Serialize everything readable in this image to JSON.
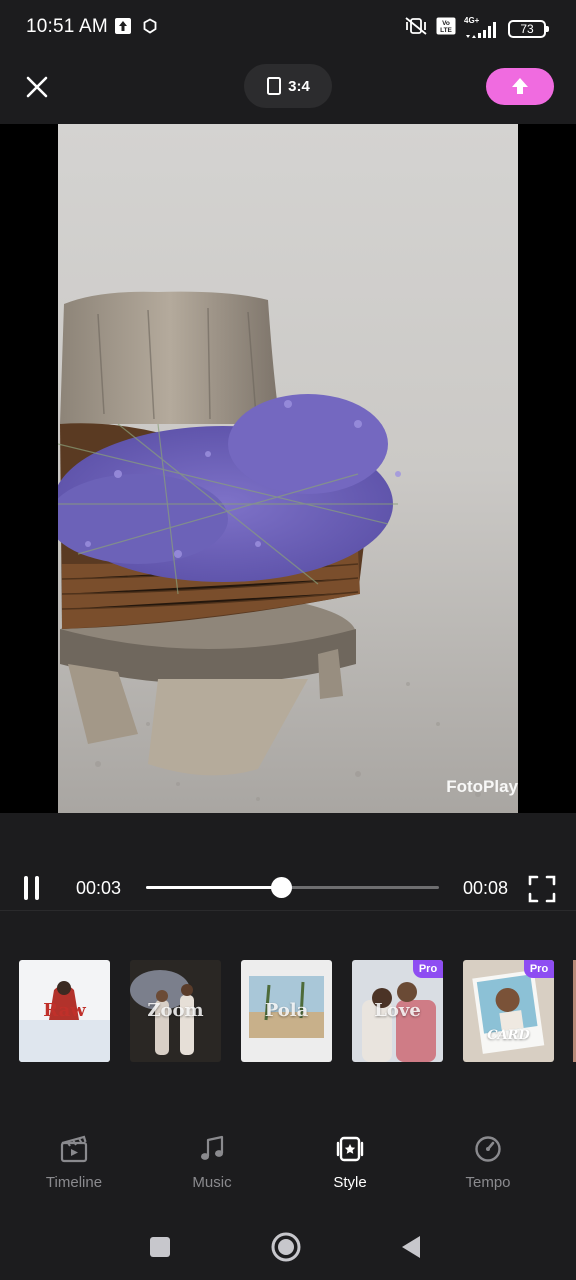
{
  "status_bar": {
    "time": "10:51 AM",
    "network_label": "4G+",
    "volte_label": "Vo LTE",
    "battery_level": "73"
  },
  "toolbar": {
    "aspect_ratio": "3:4",
    "accent_color": "#f06be0"
  },
  "preview": {
    "watermark": "FotoPlay"
  },
  "player": {
    "current_time": "00:03",
    "total_time": "00:08",
    "progress": 0.46
  },
  "style_presets": [
    {
      "label": "Raw",
      "pro": false,
      "selected": true
    },
    {
      "label": "Zoom",
      "pro": false,
      "selected": false
    },
    {
      "label": "Pola",
      "pro": false,
      "selected": false
    },
    {
      "label": "Love",
      "pro": true,
      "selected": false
    },
    {
      "label": "CARD",
      "pro": true,
      "selected": false
    }
  ],
  "pro_badge_label": "Pro",
  "tabs": [
    {
      "label": "Timeline",
      "icon": "film-icon",
      "active": false
    },
    {
      "label": "Music",
      "icon": "music-note-icon",
      "active": false
    },
    {
      "label": "Style",
      "icon": "style-frame-icon",
      "active": true
    },
    {
      "label": "Tempo",
      "icon": "speedometer-icon",
      "active": false
    }
  ]
}
